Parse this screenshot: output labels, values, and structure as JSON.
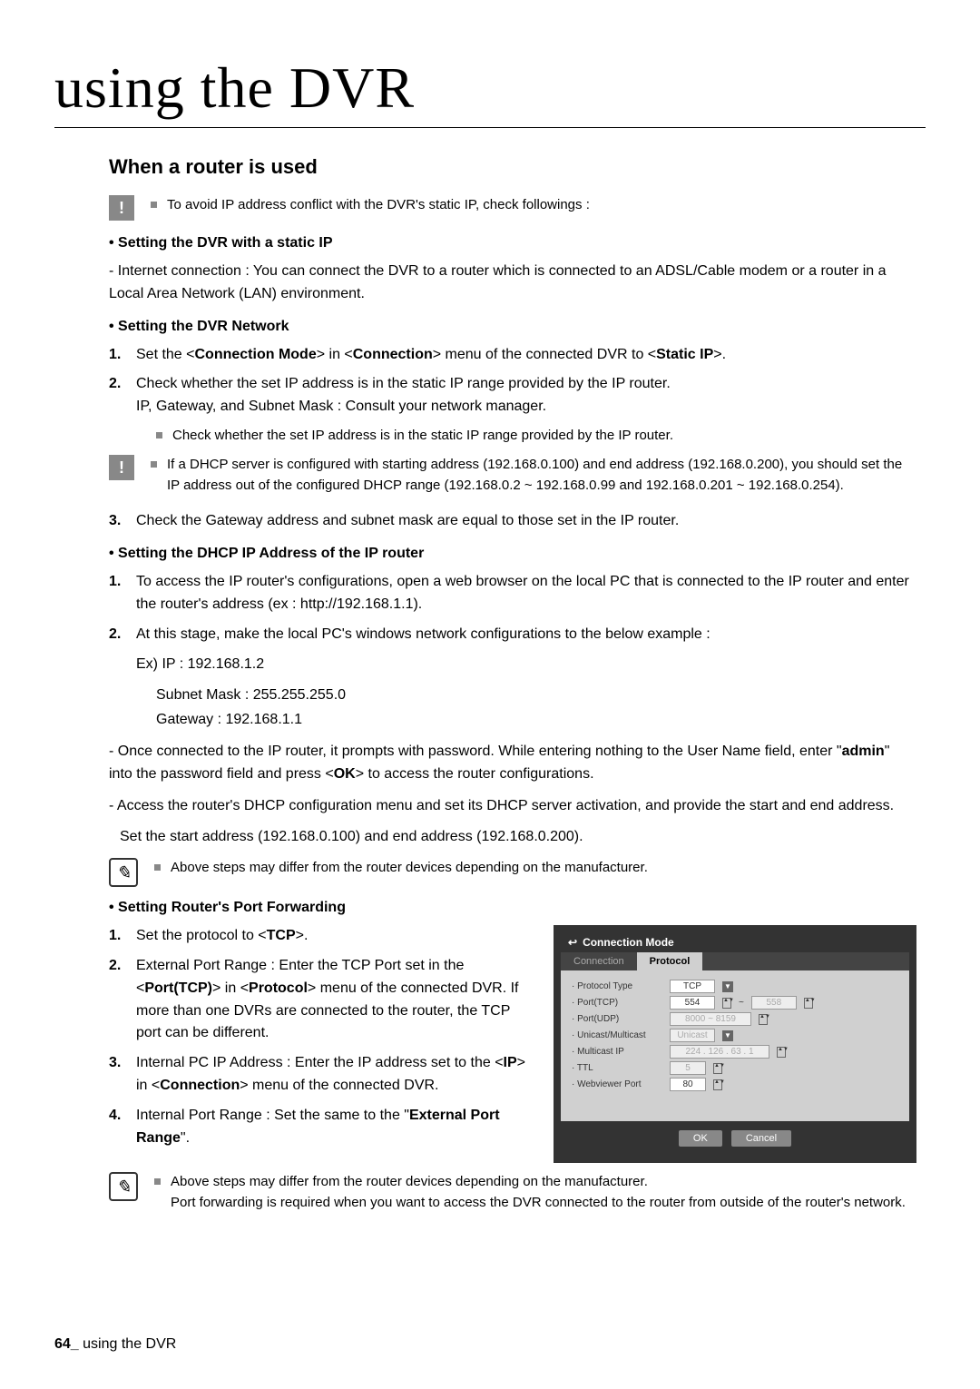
{
  "chapter_title": "using the DVR",
  "section_title": "When a router is used",
  "warn1": "To avoid IP address conflict with the DVR's static IP, check followings :",
  "sub1_title": "• Setting the DVR with a static IP",
  "sub1_p1": "- Internet connection : You can connect the DVR to a router which is connected to an ADSL/Cable modem or a router in a Local Area Network (LAN) environment.",
  "sub2_title": "• Setting the DVR Network",
  "s2_i1_num": "1.",
  "s2_i1_a": "Set the <",
  "s2_i1_b": "Connection Mode",
  "s2_i1_c": "> in <",
  "s2_i1_d": "Connection",
  "s2_i1_e": "> menu of the connected DVR to <",
  "s2_i1_f": "Static IP",
  "s2_i1_g": ">.",
  "s2_i2_num": "2.",
  "s2_i2_l1": "Check whether the set IP address is in the static IP range provided by the IP router.",
  "s2_i2_l2": "IP, Gateway, and Subnet Mask : Consult your network manager.",
  "s2_i2_b1": "Check whether the set IP address is in the static IP range provided by the IP router.",
  "warn2": "If a DHCP server is configured with starting address (192.168.0.100) and end address (192.168.0.200), you should set the IP address out of the configured DHCP range (192.168.0.2 ~ 192.168.0.99 and 192.168.0.201 ~ 192.168.0.254).",
  "s2_i3_num": "3.",
  "s2_i3": "Check the Gateway address and subnet mask are equal to those set in the IP router.",
  "sub3_title": "• Setting the DHCP IP Address of the IP router",
  "s3_i1_num": "1.",
  "s3_i1": "To access the IP router's configurations, open a web browser on the local PC that is connected to the IP router and enter the router's address (ex : http://192.168.1.1).",
  "s3_i2_num": "2.",
  "s3_i2": "At this stage, make the local PC's windows network configurations to the below example :",
  "s3_ex1": "Ex) IP : 192.168.1.2",
  "s3_ex2": "Subnet Mask : 255.255.255.0",
  "s3_ex3": "Gateway : 192.168.1.1",
  "s3_p1a": "- Once connected to the IP router, it prompts with password. While entering nothing to the User Name field, enter \"",
  "s3_p1b": "admin",
  "s3_p1c": "\" into the password field and press <",
  "s3_p1d": "OK",
  "s3_p1e": "> to access the router configurations.",
  "s3_p2": "- Access the router's DHCP configuration menu and set its DHCP server activation, and provide the start and end address.",
  "s3_p3": "Set the start address (192.168.0.100) and end address (192.168.0.200).",
  "note1": "Above steps may differ from the router devices depending on the manufacturer.",
  "sub4_title": "• Setting Router's Port Forwarding",
  "s4_i1_num": "1.",
  "s4_i1a": "Set the protocol to <",
  "s4_i1b": "TCP",
  "s4_i1c": ">.",
  "s4_i2_num": "2.",
  "s4_i2a": "External Port Range : Enter the TCP Port set in the <",
  "s4_i2b": "Port(TCP)",
  "s4_i2c": "> in <",
  "s4_i2d": "Protocol",
  "s4_i2e": "> menu of the connected DVR. If more than one DVRs are connected to the router, the TCP port can be different.",
  "s4_i3_num": "3.",
  "s4_i3a": "Internal PC IP Address : Enter the IP address set to the <",
  "s4_i3b": "IP",
  "s4_i3c": "> in <",
  "s4_i3d": "Connection",
  "s4_i3e": "> menu of the connected DVR.",
  "s4_i4_num": "4.",
  "s4_i4a": "Internal Port Range : Set the same to the \"",
  "s4_i4b": "External Port Range",
  "s4_i4c": "\".",
  "note2a": "Above steps may differ from the router devices depending on the manufacturer.",
  "note2b": "Port forwarding is required when you want to access the DVR connected to the router from outside of the router's network.",
  "footer_page": "64_",
  "footer_text": " using the DVR",
  "scr": {
    "title": "Connection Mode",
    "tab1": "Connection",
    "tab2": "Protocol",
    "r1l": "· Protocol Type",
    "r1v": "TCP",
    "r2l": "· Port(TCP)",
    "r2v1": "554",
    "r2v2": "558",
    "r3l": "· Port(UDP)",
    "r3v": "8000 ~ 8159",
    "r4l": "· Unicast/Multicast",
    "r4v": "Unicast",
    "r5l": "· Multicast IP",
    "r5v": "224 . 126 . 63 . 1",
    "r6l": "· TTL",
    "r6v": "5",
    "r7l": "· Webviewer Port",
    "r7v": "80",
    "ok": "OK",
    "cancel": "Cancel"
  }
}
